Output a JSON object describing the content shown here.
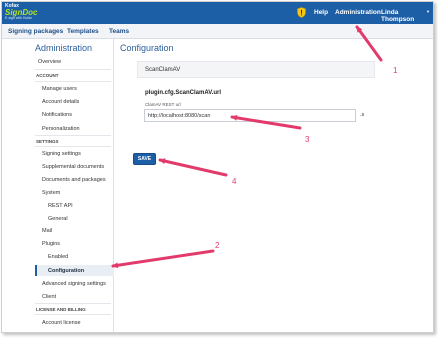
{
  "header": {
    "logo_line1": "Kofax",
    "logo_line2": "SignDoc",
    "logo_tagline": "E-sign with Kofax",
    "help": "Help",
    "administration": "Administration",
    "user": "Linda Thompson",
    "caret": "▼",
    "brand_color": "#1d5fa6"
  },
  "subnav": {
    "items": [
      "Signing packages",
      "Templates",
      "Teams"
    ]
  },
  "sidebar": {
    "title": "Administration",
    "overview": "Overview",
    "account_head": "ACCOUNT",
    "manage_users": "Manage users",
    "account_details": "Account details",
    "notifications": "Notifications",
    "personalization": "Personalization",
    "settings_head": "SETTINGS",
    "signing_settings": "Signing settings",
    "supplemental_documents": "Supplemental documents",
    "documents_and_packages": "Documents and packages",
    "system": "System",
    "rest_api": "REST API",
    "general": "General",
    "mail": "Mail",
    "plugins": "Plugins",
    "enabled": "Enabled",
    "configuration": "Configuration",
    "advanced_signing_settings": "Advanced signing settings",
    "client": "Client",
    "license_head": "LICENSE AND BILLING",
    "account_license": "Account license"
  },
  "main": {
    "title": "Configuration",
    "plugin_name": "ScanClamAV",
    "config_key": "plugin.cfg.ScanClamAV.url",
    "field_label": "ClamAV REST url",
    "field_value": "http://localhost:8080/scan",
    "field_suffix": ".s",
    "save_label": "SAVE"
  },
  "annotations": {
    "color": "#e23b6b",
    "labels": [
      "1",
      "2",
      "3",
      "4"
    ]
  }
}
